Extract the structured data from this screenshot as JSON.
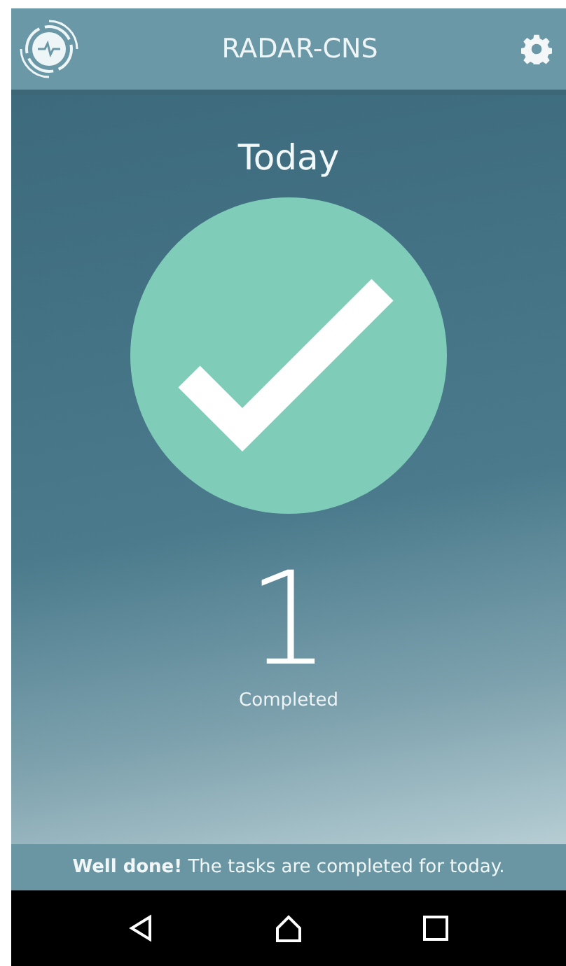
{
  "app_bar": {
    "title": "RADAR-CNS"
  },
  "main": {
    "heading": "Today",
    "completed": true,
    "count": "1",
    "count_label": "Completed"
  },
  "banner": {
    "message": "**Well done!** The tasks are completed for today."
  }
}
